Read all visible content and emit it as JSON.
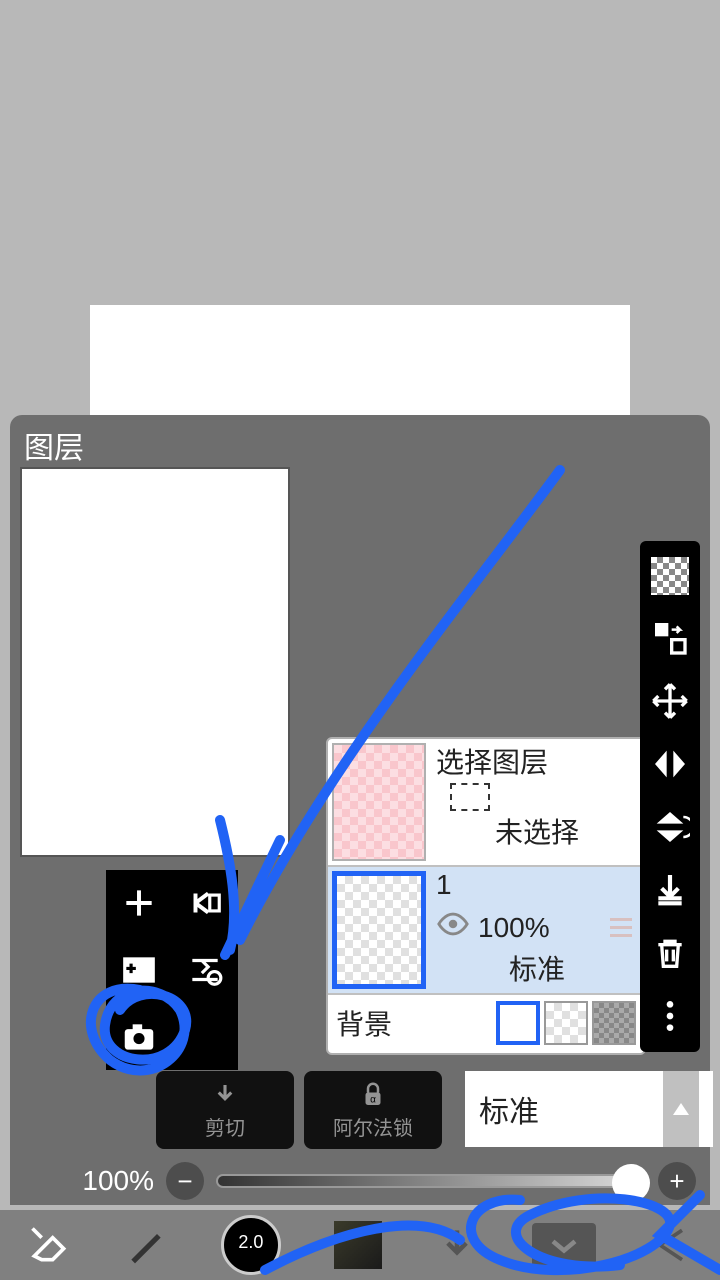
{
  "panel": {
    "title": "图层"
  },
  "layer_tools": {
    "add": "add-icon",
    "duplicate": "duplicate-icon",
    "paste": "paste-icon",
    "swap": "swap-icon",
    "camera": "camera-icon"
  },
  "layers": [
    {
      "name": "选择图层",
      "status": "未选择"
    },
    {
      "name": "1",
      "opacity": "100%",
      "blend": "标准"
    }
  ],
  "background": {
    "label": "背景"
  },
  "buttons": {
    "clip": "剪切",
    "alpha_lock": "阿尔法锁"
  },
  "blend_mode": "标准",
  "opacity": {
    "value": "100%"
  },
  "bottom": {
    "brush_size": "2.0"
  }
}
